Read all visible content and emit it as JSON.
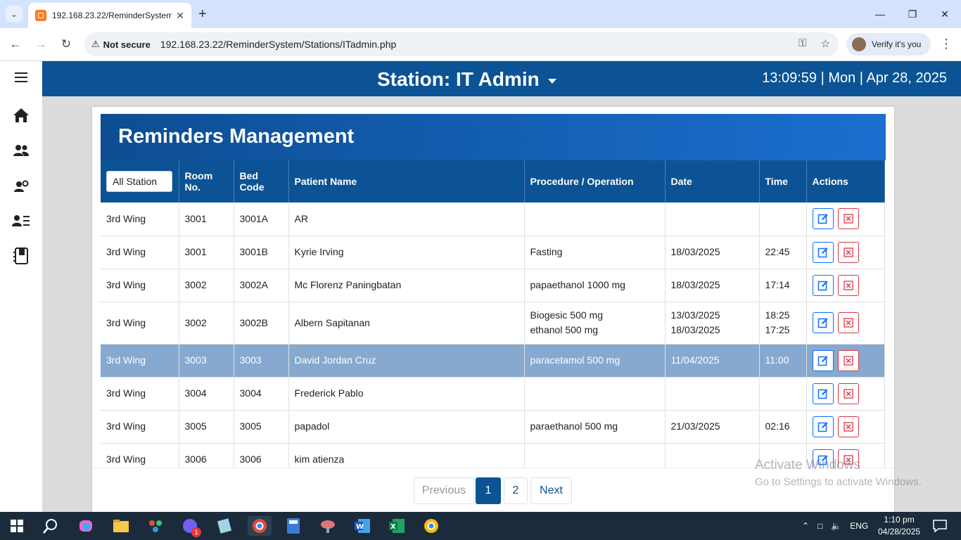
{
  "browser": {
    "tab_title": "192.168.23.22/ReminderSystem",
    "security_label": "Not secure",
    "url": "192.168.23.22/ReminderSystem/Stations/ITadmin.php",
    "verify_label": "Verify it's you"
  },
  "header": {
    "station_label": "Station: IT Admin",
    "clock": "13:09:59 | Mon | Apr 28, 2025"
  },
  "page": {
    "title": "Reminders Management",
    "filter_value": "All Station"
  },
  "table": {
    "headers": [
      "Room No.",
      "Bed Code",
      "Patient Name",
      "Procedure / Operation",
      "Date",
      "Time",
      "Actions"
    ],
    "rows": [
      {
        "wing": "3rd Wing",
        "room": "3001",
        "bed": "3001A",
        "patient": "AR",
        "proc1": "",
        "proc2": "",
        "date1": "",
        "date2": "",
        "time1": "",
        "time2": ""
      },
      {
        "wing": "3rd Wing",
        "room": "3001",
        "bed": "3001B",
        "patient": "Kyrie Irving",
        "proc1": "Fasting",
        "proc2": "",
        "date1": "18/03/2025",
        "date2": "",
        "time1": "22:45",
        "time2": ""
      },
      {
        "wing": "3rd Wing",
        "room": "3002",
        "bed": "3002A",
        "patient": "Mc Florenz Paningbatan",
        "proc1": "papaethanol 1000 mg",
        "proc2": "",
        "date1": "18/03/2025",
        "date2": "",
        "time1": "17:14",
        "time2": ""
      },
      {
        "wing": "3rd Wing",
        "room": "3002",
        "bed": "3002B",
        "patient": "Albern Sapitanan",
        "proc1": "Biogesic 500 mg",
        "proc2": "ethanol 500 mg",
        "date1": "13/03/2025",
        "date2": "18/03/2025",
        "time1": "18:25",
        "time2": "17:25"
      },
      {
        "wing": "3rd Wing",
        "room": "3003",
        "bed": "3003",
        "patient": "David Jordan Cruz",
        "proc1": "paracetamol 500 mg",
        "proc2": "",
        "date1": "11/04/2025",
        "date2": "",
        "time1": "11:00",
        "time2": ""
      },
      {
        "wing": "3rd Wing",
        "room": "3004",
        "bed": "3004",
        "patient": "Frederick Pablo",
        "proc1": "",
        "proc2": "",
        "date1": "",
        "date2": "",
        "time1": "",
        "time2": ""
      },
      {
        "wing": "3rd Wing",
        "room": "3005",
        "bed": "3005",
        "patient": "papadol",
        "proc1": "paraethanol 500 mg",
        "proc2": "",
        "date1": "21/03/2025",
        "date2": "",
        "time1": "02:16",
        "time2": ""
      },
      {
        "wing": "3rd Wing",
        "room": "3006",
        "bed": "3006",
        "patient": "kim atienza",
        "proc1": "",
        "proc2": "",
        "date1": "",
        "date2": "",
        "time1": "",
        "time2": ""
      }
    ]
  },
  "pagination": {
    "previous": "Previous",
    "page1": "1",
    "page2": "2",
    "next": "Next"
  },
  "watermark": {
    "line1": "Activate Windows",
    "line2": "Go to Settings to activate Windows."
  },
  "taskbar": {
    "lang": "ENG",
    "time": "1:10 pm",
    "date": "04/28/2025",
    "badge": "1"
  },
  "colors": {
    "primary": "#0b5394",
    "selected_row": "#87a9cf",
    "edit": "#0d6efd",
    "delete": "#dc3545"
  }
}
